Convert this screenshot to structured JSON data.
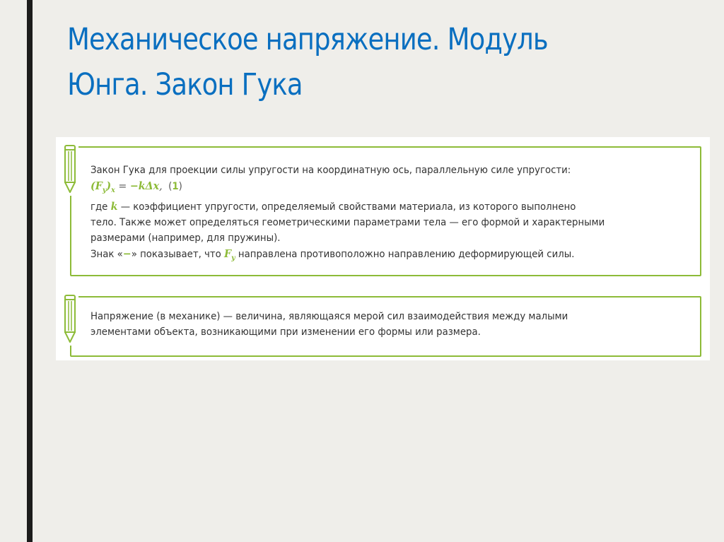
{
  "slide": {
    "title": "Механическое напряжение. Модуль Юнга. Закон Гука"
  },
  "colors": {
    "title": "#0a6fc0",
    "accent": "#8dbb38",
    "background": "#efeeea",
    "left_bar": "#1c1c1c"
  },
  "icons": [
    "pencil-icon",
    "pencil-icon"
  ],
  "note1": {
    "line1": "Закон Гука для проекции силы упругости на координатную ось, параллельную силе упругости:",
    "formula_lhs": "(F",
    "formula_sub_y": "y",
    "formula_paren_close": ")",
    "formula_sub_x": "x",
    "formula_eq": " = ",
    "formula_rhs": "−kΔx",
    "formula_comma": ",",
    "eq_open": "(",
    "eq_number": "1",
    "eq_close": ")",
    "line3_start": "где ",
    "k_symbol": "k",
    "line3_end": " — коэффициент упругости, определяемый свойствами материала, из которого выполнено",
    "line4": "тело. Также может определяться геометрическими параметрами тела — его формой и характерными",
    "line5": "размерами (например, для пружины).",
    "line6_start": "Знак «",
    "minus_symbol": "−",
    "line6_mid": "» показывает, что ",
    "f_symbol": "F",
    "f_sub": "y",
    "line6_end": " направлена противоположно направлению деформирующей силы."
  },
  "note2": {
    "line1": "Напряжение (в механике) — величина, являющаяся мерой сил взаимодействия между малыми",
    "line2": "элементами объекта, возникающими при изменении его формы или размера."
  }
}
